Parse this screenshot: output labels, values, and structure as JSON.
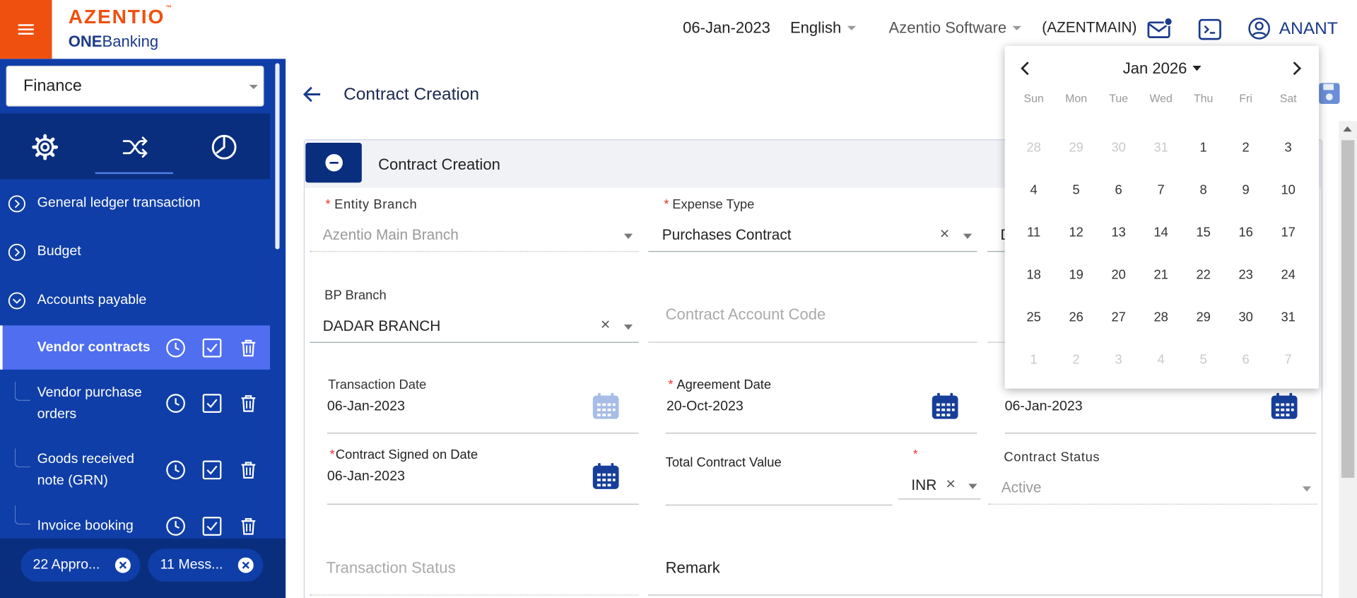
{
  "header": {
    "logo_brand": "AZENTIO",
    "logo_tm": "™",
    "logo_one": "ONE",
    "logo_banking": "Banking",
    "date": "06-Jan-2023",
    "language": "English",
    "company": "Azentio Software",
    "branch_code": "(AZENTMAIN)",
    "user": "ANANT"
  },
  "sidebar": {
    "module": "Finance",
    "nav": [
      {
        "label": "General ledger transaction"
      },
      {
        "label": "Budget"
      },
      {
        "label": "Accounts payable"
      }
    ],
    "sub_items": [
      {
        "label": "Vendor contracts"
      },
      {
        "label": "Vendor purchase orders"
      },
      {
        "label": "Goods received note (GRN)"
      },
      {
        "label": "Invoice booking"
      }
    ],
    "pills": [
      {
        "label": "22 Appro..."
      },
      {
        "label": "11 Mess..."
      }
    ]
  },
  "page": {
    "title": "Contract Creation",
    "section_title": "Contract Creation"
  },
  "form": {
    "entity_branch": {
      "label": "Entity Branch",
      "value": "Azentio Main Branch"
    },
    "expense_type": {
      "label": "Expense Type",
      "value": "Purchases Contract"
    },
    "third_col_partial": "D",
    "bp_branch": {
      "label": "BP Branch",
      "value": "DADAR BRANCH"
    },
    "contract_account_code": {
      "placeholder": "Contract Account Code"
    },
    "transaction_date": {
      "label": "Transaction Date",
      "value": "06-Jan-2023"
    },
    "agreement_date": {
      "label": "Agreement Date",
      "value": "20-Oct-2023"
    },
    "third_date": {
      "value": "06-Jan-2023"
    },
    "contract_signed_date": {
      "label": "Contract Signed on Date",
      "value": "06-Jan-2023"
    },
    "total_contract_value": {
      "label": "Total Contract Value"
    },
    "currency": {
      "value": "INR"
    },
    "contract_status": {
      "label": "Contract Status",
      "value": "Active"
    },
    "transaction_status": {
      "placeholder": "Transaction Status"
    },
    "remark": {
      "label": "Remark"
    }
  },
  "calendar": {
    "title": "Jan 2026",
    "weekdays": [
      "Sun",
      "Mon",
      "Tue",
      "Wed",
      "Thu",
      "Fri",
      "Sat"
    ],
    "weeks": [
      [
        "28",
        "29",
        "30",
        "31",
        "1",
        "2",
        "3"
      ],
      [
        "4",
        "5",
        "6",
        "7",
        "8",
        "9",
        "10"
      ],
      [
        "11",
        "12",
        "13",
        "14",
        "15",
        "16",
        "17"
      ],
      [
        "18",
        "19",
        "20",
        "21",
        "22",
        "23",
        "24"
      ],
      [
        "25",
        "26",
        "27",
        "28",
        "29",
        "30",
        "31"
      ],
      [
        "1",
        "2",
        "3",
        "4",
        "5",
        "6",
        "7"
      ]
    ],
    "muted": [
      [
        true,
        true,
        true,
        true,
        false,
        false,
        false
      ],
      [
        false,
        false,
        false,
        false,
        false,
        false,
        false
      ],
      [
        false,
        false,
        false,
        false,
        false,
        false,
        false
      ],
      [
        false,
        false,
        false,
        false,
        false,
        false,
        false
      ],
      [
        false,
        false,
        false,
        false,
        false,
        false,
        false
      ],
      [
        true,
        true,
        true,
        true,
        true,
        true,
        true
      ]
    ]
  },
  "colors": {
    "brand_orange": "#f0500f",
    "sidebar_blue": "#0f3ea8",
    "sidebar_dark": "#0a2e7e",
    "active_item": "#4f6ef0",
    "required_red": "#e53935"
  }
}
